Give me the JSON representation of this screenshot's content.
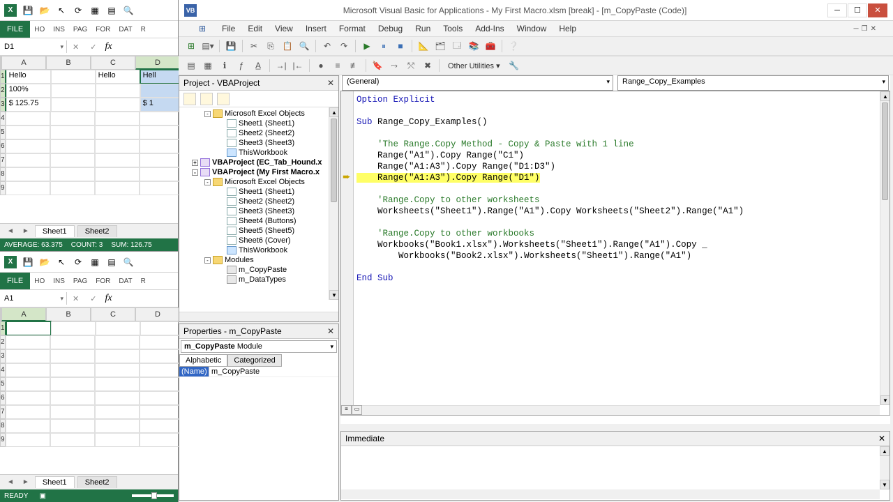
{
  "excel_top": {
    "ribbon_tabs": [
      "HO",
      "INS",
      "PAG",
      "FOR",
      "DAT",
      "R"
    ],
    "file_label": "FILE",
    "namebox": "D1",
    "cols": [
      "A",
      "B",
      "C",
      "D"
    ],
    "rows": [
      "1",
      "2",
      "3",
      "4",
      "5",
      "6",
      "7",
      "8",
      "9"
    ],
    "cells": {
      "A1": "Hello",
      "A2": "100%",
      "A3": "$ 125.75",
      "C1": "Hello",
      "D1": "Hell",
      "D3": "$ 1"
    },
    "sheet_tabs": [
      "Sheet1",
      "Sheet2"
    ],
    "status": {
      "avg": "AVERAGE: 63.375",
      "count": "COUNT: 3",
      "sum": "SUM: 126.75"
    }
  },
  "excel_bot": {
    "ribbon_tabs": [
      "HO",
      "INS",
      "PAG",
      "FOR",
      "DAT",
      "R"
    ],
    "file_label": "FILE",
    "namebox": "A1",
    "cols": [
      "A",
      "B",
      "C",
      "D"
    ],
    "rows": [
      "1",
      "2",
      "3",
      "4",
      "5",
      "6",
      "7",
      "8",
      "9"
    ],
    "sheet_tabs": [
      "Sheet1",
      "Sheet2"
    ],
    "status_ready": "READY"
  },
  "vbe": {
    "title": "Microsoft Visual Basic for Applications - My First Macro.xlsm [break] - [m_CopyPaste (Code)]",
    "menus": [
      "File",
      "Edit",
      "View",
      "Insert",
      "Format",
      "Debug",
      "Run",
      "Tools",
      "Add-Ins",
      "Window",
      "Help"
    ],
    "other_utilities": "Other Utilities ▾",
    "project": {
      "title": "Project - VBAProject",
      "items": [
        {
          "t": "Microsoft Excel Objects",
          "lvl": 2,
          "ico": "folder",
          "exp": "-"
        },
        {
          "t": "Sheet1 (Sheet1)",
          "lvl": 3,
          "ico": "sheet"
        },
        {
          "t": "Sheet2 (Sheet2)",
          "lvl": 3,
          "ico": "sheet"
        },
        {
          "t": "Sheet3 (Sheet3)",
          "lvl": 3,
          "ico": "sheet"
        },
        {
          "t": "ThisWorkbook",
          "lvl": 3,
          "ico": "book"
        },
        {
          "t": "VBAProject (EC_Tab_Hound.x",
          "lvl": 1,
          "ico": "proj",
          "bold": true,
          "exp": "+"
        },
        {
          "t": "VBAProject (My First Macro.x",
          "lvl": 1,
          "ico": "proj",
          "bold": true,
          "exp": "-"
        },
        {
          "t": "Microsoft Excel Objects",
          "lvl": 2,
          "ico": "folder",
          "exp": "-"
        },
        {
          "t": "Sheet1 (Sheet1)",
          "lvl": 3,
          "ico": "sheet"
        },
        {
          "t": "Sheet2 (Sheet2)",
          "lvl": 3,
          "ico": "sheet"
        },
        {
          "t": "Sheet3 (Sheet3)",
          "lvl": 3,
          "ico": "sheet"
        },
        {
          "t": "Sheet4 (Buttons)",
          "lvl": 3,
          "ico": "sheet"
        },
        {
          "t": "Sheet5 (Sheet5)",
          "lvl": 3,
          "ico": "sheet"
        },
        {
          "t": "Sheet6 (Cover)",
          "lvl": 3,
          "ico": "sheet"
        },
        {
          "t": "ThisWorkbook",
          "lvl": 3,
          "ico": "book"
        },
        {
          "t": "Modules",
          "lvl": 2,
          "ico": "folder",
          "exp": "-"
        },
        {
          "t": "m_CopyPaste",
          "lvl": 3,
          "ico": "mod"
        },
        {
          "t": "m_DataTypes",
          "lvl": 3,
          "ico": "mod"
        }
      ]
    },
    "properties": {
      "title": "Properties - m_CopyPaste",
      "object": "m_CopyPaste Module",
      "tabs": [
        "Alphabetic",
        "Categorized"
      ],
      "name_label": "(Name)",
      "name_value": "m_CopyPaste"
    },
    "code": {
      "dd_left": "(General)",
      "dd_right": "Range_Copy_Examples",
      "lines": [
        {
          "txt": "Option Explicit",
          "cls": "kw"
        },
        {
          "txt": ""
        },
        {
          "txt": "Sub Range_Copy_Examples()",
          "cls": "kw_mix",
          "sub": "Sub ",
          "rest": "Range_Copy_Examples()"
        },
        {
          "txt": ""
        },
        {
          "txt": "    'The Range.Copy Method - Copy & Paste with 1 line",
          "cls": "cmt"
        },
        {
          "txt": "    Range(\"A1\").Copy Range(\"C1\")"
        },
        {
          "txt": "    Range(\"A1:A3\").Copy Range(\"D1:D3\")"
        },
        {
          "txt": "    Range(\"A1:A3\").Copy Range(\"D1\")",
          "cls": "hl"
        },
        {
          "txt": ""
        },
        {
          "txt": "    'Range.Copy to other worksheets",
          "cls": "cmt"
        },
        {
          "txt": "    Worksheets(\"Sheet1\").Range(\"A1\").Copy Worksheets(\"Sheet2\").Range(\"A1\")"
        },
        {
          "txt": ""
        },
        {
          "txt": "    'Range.Copy to other workbooks",
          "cls": "cmt"
        },
        {
          "txt": "    Workbooks(\"Book1.xlsx\").Worksheets(\"Sheet1\").Range(\"A1\").Copy _"
        },
        {
          "txt": "        Workbooks(\"Book2.xlsx\").Worksheets(\"Sheet1\").Range(\"A1\")"
        },
        {
          "txt": ""
        },
        {
          "txt": "End Sub",
          "cls": "kw"
        }
      ]
    },
    "immediate": {
      "title": "Immediate"
    }
  }
}
